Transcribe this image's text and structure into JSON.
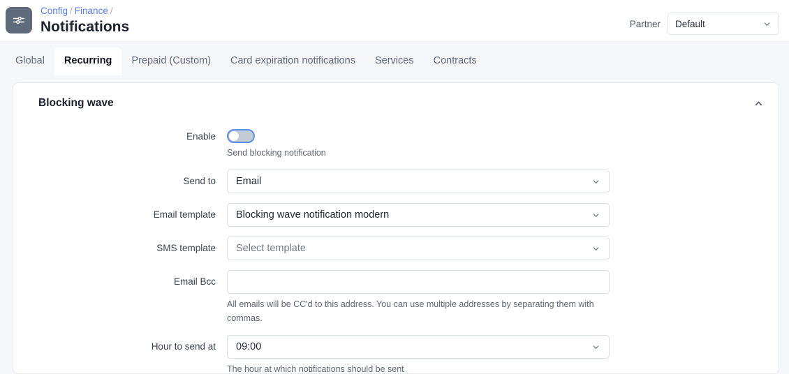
{
  "header": {
    "app_icon": "sliders-icon",
    "breadcrumb": [
      {
        "label": "Config",
        "link": true
      },
      {
        "label": "Finance",
        "link": true
      }
    ],
    "breadcrumb_separator": "/",
    "title": "Notifications",
    "partner": {
      "label": "Partner",
      "value": "Default",
      "icon": "chevron-down-icon"
    }
  },
  "tabs": [
    {
      "label": "Global",
      "active": false
    },
    {
      "label": "Recurring",
      "active": true
    },
    {
      "label": "Prepaid (Custom)",
      "active": false
    },
    {
      "label": "Card expiration notifications",
      "active": false
    },
    {
      "label": "Services",
      "active": false
    },
    {
      "label": "Contracts",
      "active": false
    }
  ],
  "card": {
    "title": "Blocking wave",
    "collapse_icon": "chevron-up-icon",
    "fields": {
      "enable": {
        "label": "Enable",
        "checked": false,
        "helper": "Send blocking notification"
      },
      "send_to": {
        "label": "Send to",
        "value": "Email",
        "icon": "chevron-down-icon"
      },
      "email_template": {
        "label": "Email template",
        "value": "Blocking wave notification modern",
        "icon": "chevron-down-icon"
      },
      "sms_template": {
        "label": "SMS template",
        "value": "Select template",
        "icon": "chevron-down-icon"
      },
      "email_bcc": {
        "label": "Email Bcc",
        "value": "",
        "placeholder": "",
        "helper": "All emails will be CC'd to this address. You can use multiple addresses by separating them with commas."
      },
      "hour_to_send_at": {
        "label": "Hour to send at",
        "value": "09:00",
        "icon": "chevron-down-icon",
        "helper": "The hour at which notifications should be sent"
      }
    }
  },
  "colors": {
    "accent_link": "#5b7cfa",
    "toggle_focus_ring": "#5b8ff0",
    "page_background": "#f5f7fb",
    "app_icon_background": "#5f6b7a",
    "border": "#d7dce4"
  }
}
